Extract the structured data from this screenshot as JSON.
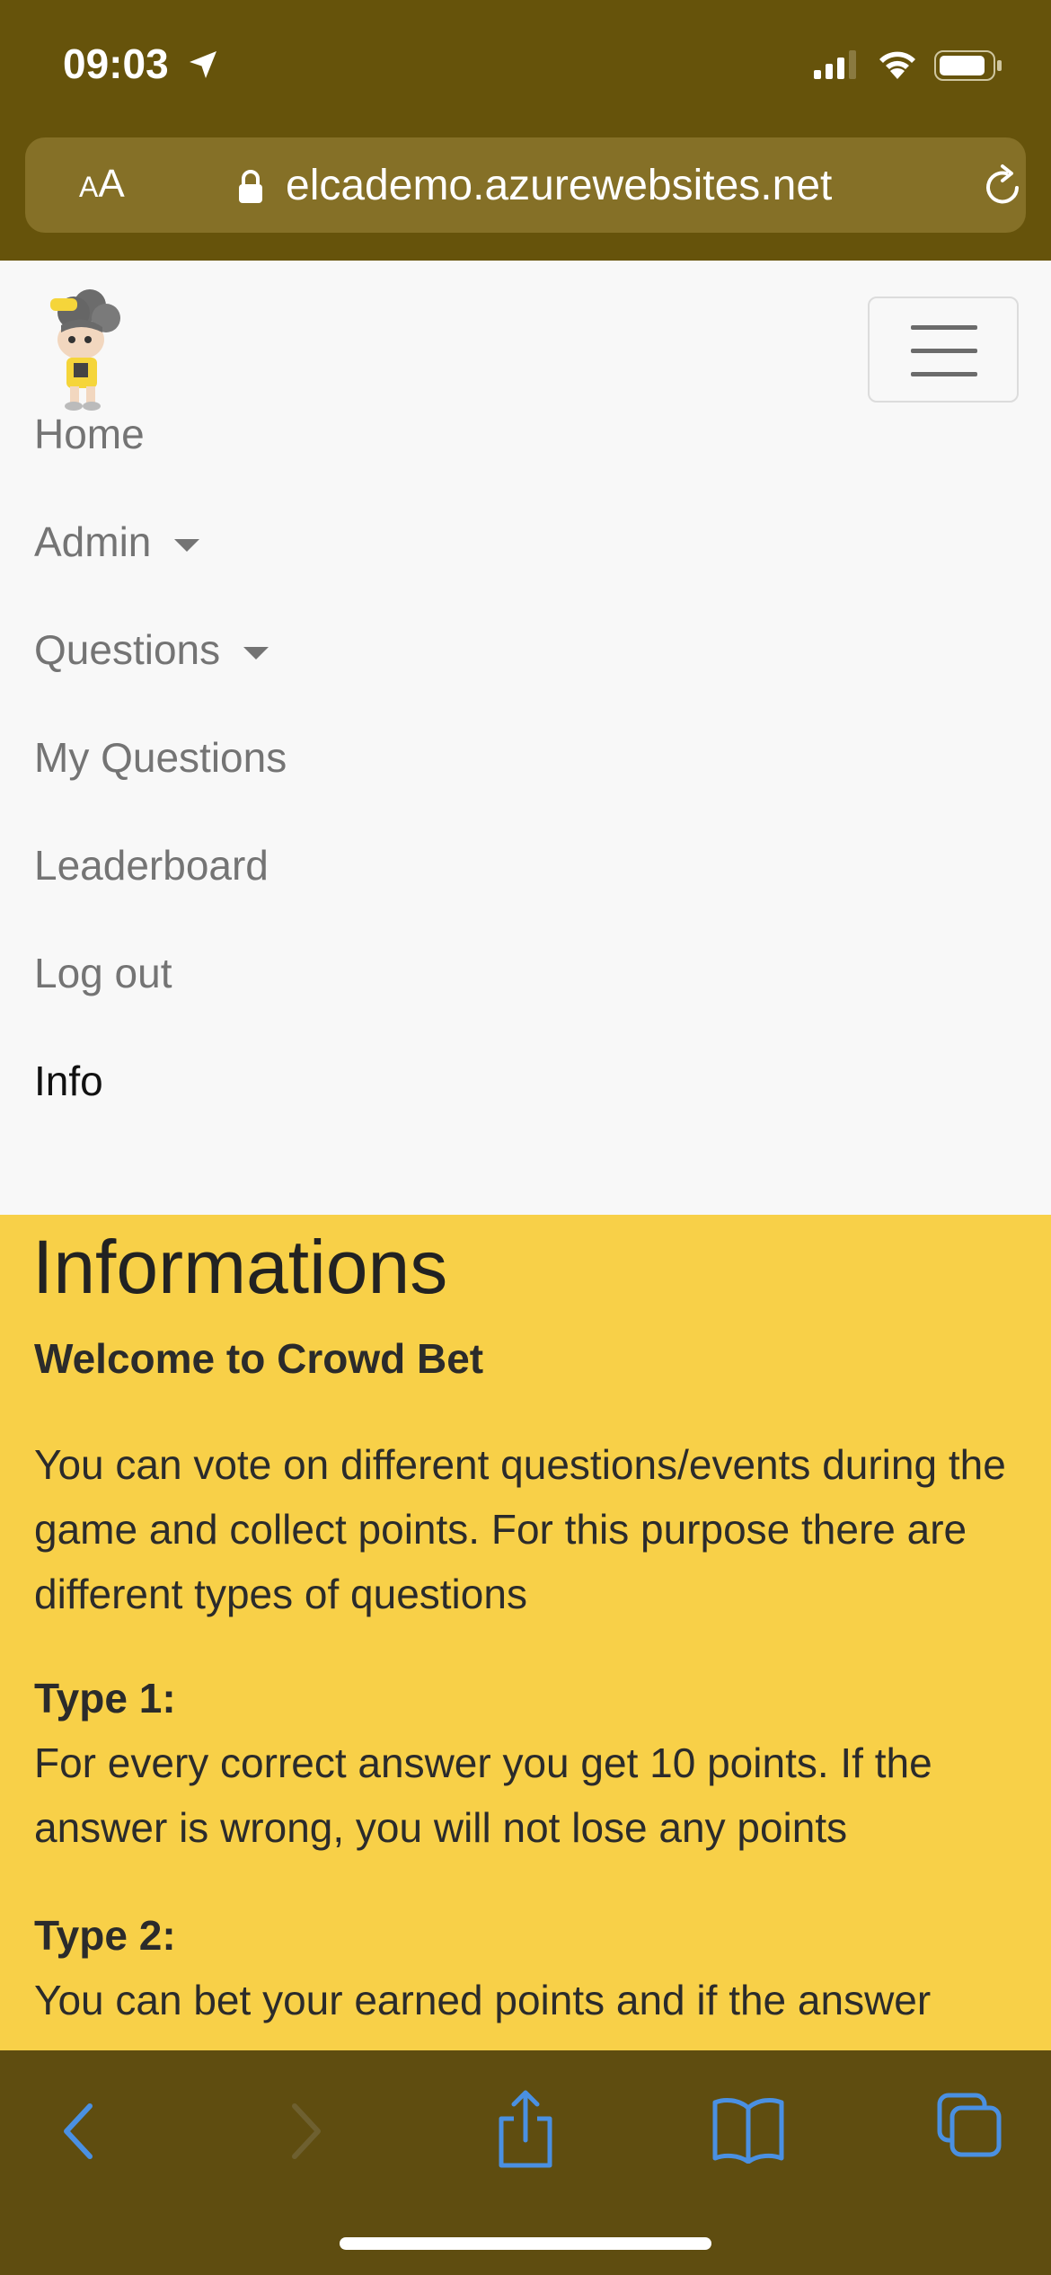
{
  "status_bar": {
    "time": "09:03"
  },
  "browser": {
    "text_size_label_small": "A",
    "text_size_label_large": "A",
    "url": "elcademo.azurewebsites.net"
  },
  "navbar": {
    "items": [
      {
        "label": "Home",
        "dropdown": false,
        "active": false
      },
      {
        "label": "Admin",
        "dropdown": true,
        "active": false
      },
      {
        "label": "Questions",
        "dropdown": true,
        "active": false
      },
      {
        "label": "My Questions",
        "dropdown": false,
        "active": false
      },
      {
        "label": "Leaderboard",
        "dropdown": false,
        "active": false
      },
      {
        "label": "Log out",
        "dropdown": false,
        "active": false
      },
      {
        "label": "Info",
        "dropdown": false,
        "active": true
      }
    ]
  },
  "content": {
    "title": "Informations",
    "welcome": "Welcome to Crowd Bet",
    "intro": "You can vote on different questions/events during the game and collect points. For this purpose there are different types of questions",
    "type1_heading": "Type 1:",
    "type1_text": "For every correct answer you get 10 points. If the answer is wrong, you will not lose any points",
    "type2_heading": "Type 2:",
    "type2_text": "You can bet your earned points and if the answer"
  },
  "colors": {
    "browser_chrome": "#66530b",
    "content_background": "#f8d048",
    "toolbar_icons": "#4a90e2"
  },
  "icons": {
    "back": "chevron-left-icon",
    "forward": "chevron-right-icon",
    "share": "share-icon",
    "bookmarks": "book-icon",
    "tabs": "tabs-icon"
  }
}
